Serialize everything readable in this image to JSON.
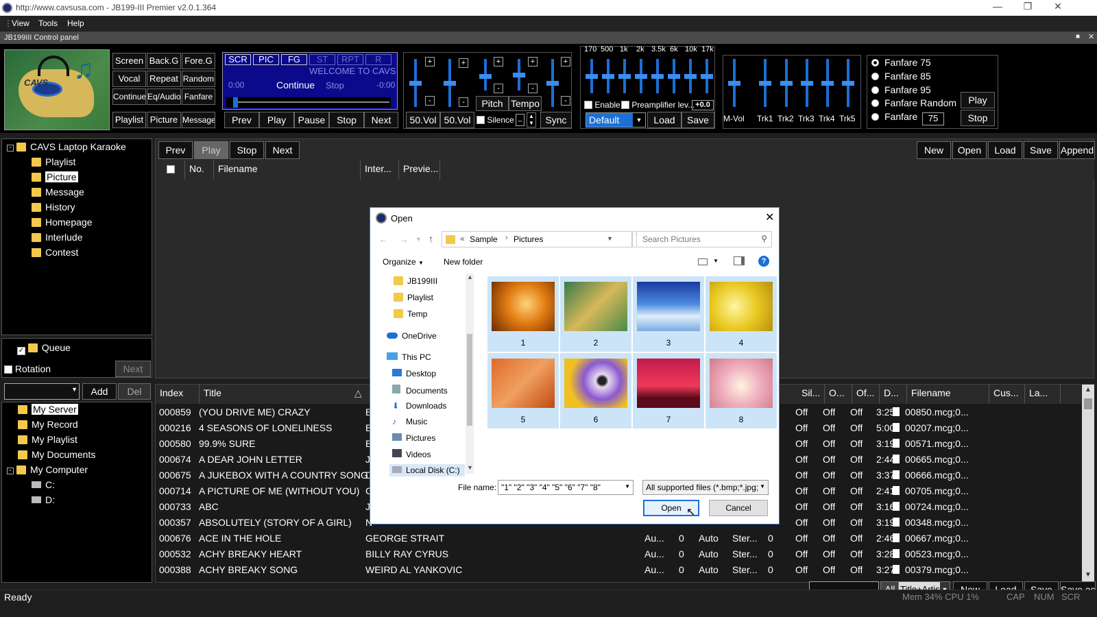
{
  "window": {
    "title": "http://www.cavsusa.com - JB199-III Premier v2.0.1.364"
  },
  "menu": [
    "View",
    "Tools",
    "Help"
  ],
  "control_panel_title": "JB199III Control panel",
  "mode_buttons": [
    [
      "Screen",
      "Back.G",
      "Fore.G"
    ],
    [
      "Vocal",
      "Repeat",
      "Random"
    ],
    [
      "Continue",
      "Eq/Audio",
      "Fanfare"
    ],
    [
      "Playlist",
      "Picture",
      "Message"
    ]
  ],
  "display": {
    "tabs": [
      "SCR",
      "PIC",
      "FG",
      "ST",
      "RPT",
      "R"
    ],
    "welcome": "WELCOME TO CAVS",
    "time_start": "0:00",
    "mode": "Continue",
    "state": "Stop",
    "time_end": "-0:00"
  },
  "transport": [
    "Prev",
    "Play",
    "Pause",
    "Stop",
    "Next"
  ],
  "vol": {
    "vol1": "50.Vol",
    "vol2": "50.Vol",
    "silence": "Silence",
    "pitch": "Pitch",
    "tempo": "Tempo",
    "sync": "Sync"
  },
  "eq": {
    "bands": [
      "170",
      "500",
      "1k",
      "2k",
      "3.5k",
      "6k",
      "10k",
      "17k"
    ],
    "enable": "Enable",
    "preamp": "Preamplifier lev...",
    "preamp_value": "+0.0",
    "preset": "Default",
    "load": "Load",
    "save": "Save"
  },
  "tracks": [
    "M-Vol",
    "Trk1",
    "Trk2",
    "Trk3",
    "Trk4",
    "Trk5"
  ],
  "fanfare": {
    "options": [
      "Fanfare 75",
      "Fanfare 85",
      "Fanfare 95",
      "Fanfare Random",
      "Fanfare"
    ],
    "value": "75",
    "play": "Play",
    "stop": "Stop"
  },
  "tree_top": {
    "root": "CAVS Laptop Karaoke",
    "items": [
      "Playlist",
      "Picture",
      "Message",
      "History",
      "Homepage",
      "Interlude",
      "Contest"
    ]
  },
  "queue": {
    "label": "Queue",
    "rotation": "Rotation",
    "next": "Next"
  },
  "add_del": {
    "add": "Add",
    "del": "Del"
  },
  "tree_bottom": {
    "items": [
      "My Server",
      "My Record",
      "My Playlist",
      "My Documents",
      "My Computer"
    ],
    "drives": [
      "C:",
      "D:"
    ]
  },
  "playlist_toolbar": {
    "left": [
      "Prev",
      "Play",
      "Stop",
      "Next"
    ],
    "right": [
      "New",
      "Open",
      "Load",
      "Save",
      "Append"
    ]
  },
  "playlist_columns": [
    "No.",
    "Filename",
    "Inter...",
    "Previe..."
  ],
  "song_columns": [
    "Index",
    "Title",
    "Sil...",
    "O...",
    "Of...",
    "D...",
    "Filename",
    "Cus...",
    "La..."
  ],
  "songs": [
    {
      "index": "000859",
      "title": "(YOU DRIVE ME) CRAZY",
      "artist": "B",
      "a": "",
      "b": "",
      "c": "",
      "d": "",
      "e": "",
      "f": "",
      "sil": "Off",
      "o": "Off",
      "of": "Off",
      "dur": "3:25",
      "file": "00850.mcg;0..."
    },
    {
      "index": "000216",
      "title": "4 SEASONS OF LONELINESS",
      "artist": "B",
      "a": "",
      "b": "",
      "c": "",
      "d": "",
      "e": "",
      "f": "",
      "sil": "Off",
      "o": "Off",
      "of": "Off",
      "dur": "5:00",
      "file": "00207.mcg;0..."
    },
    {
      "index": "000580",
      "title": "99.9% SURE",
      "artist": "B",
      "a": "",
      "b": "",
      "c": "",
      "d": "",
      "e": "",
      "f": "",
      "sil": "Off",
      "o": "Off",
      "of": "Off",
      "dur": "3:19",
      "file": "00571.mcg;0..."
    },
    {
      "index": "000674",
      "title": "A DEAR JOHN LETTER",
      "artist": "J",
      "a": "",
      "b": "",
      "c": "",
      "d": "",
      "e": "",
      "f": "",
      "sil": "Off",
      "o": "Off",
      "of": "Off",
      "dur": "2:44",
      "file": "00665.mcg;0..."
    },
    {
      "index": "000675",
      "title": "A JUKEBOX WITH A COUNTRY SONG",
      "artist": "D",
      "a": "",
      "b": "",
      "c": "",
      "d": "",
      "e": "",
      "f": "",
      "sil": "Off",
      "o": "Off",
      "of": "Off",
      "dur": "3:37",
      "file": "00666.mcg;0..."
    },
    {
      "index": "000714",
      "title": "A PICTURE OF ME (WITHOUT YOU)",
      "artist": "C",
      "a": "",
      "b": "",
      "c": "",
      "d": "",
      "e": "",
      "f": "",
      "sil": "Off",
      "o": "Off",
      "of": "Off",
      "dur": "2:41",
      "file": "00705.mcg;0..."
    },
    {
      "index": "000733",
      "title": "ABC",
      "artist": "J",
      "a": "",
      "b": "",
      "c": "",
      "d": "",
      "e": "",
      "f": "",
      "sil": "Off",
      "o": "Off",
      "of": "Off",
      "dur": "3:16",
      "file": "00724.mcg;0..."
    },
    {
      "index": "000357",
      "title": "ABSOLUTELY (STORY OF A GIRL)",
      "artist": "N",
      "a": "",
      "b": "",
      "c": "",
      "d": "",
      "e": "",
      "f": "",
      "sil": "Off",
      "o": "Off",
      "of": "Off",
      "dur": "3:19",
      "file": "00348.mcg;0..."
    },
    {
      "index": "000676",
      "title": "ACE IN THE HOLE",
      "artist": "GEORGE STRAIT",
      "a": "Au...",
      "b": "0",
      "c": "Auto",
      "d": "Ster...",
      "e": "0",
      "f": "",
      "sil": "Off",
      "o": "Off",
      "of": "Off",
      "dur": "2:46",
      "file": "00667.mcg;0..."
    },
    {
      "index": "000532",
      "title": "ACHY BREAKY HEART",
      "artist": "BILLY RAY CYRUS",
      "a": "Au...",
      "b": "0",
      "c": "Auto",
      "d": "Ster...",
      "e": "0",
      "f": "",
      "sil": "Off",
      "o": "Off",
      "of": "Off",
      "dur": "3:28",
      "file": "00523.mcg;0..."
    },
    {
      "index": "000388",
      "title": "ACHY BREAKY SONG",
      "artist": "WEIRD AL YANKOVIC",
      "a": "Au...",
      "b": "0",
      "c": "Auto",
      "d": "Ster...",
      "e": "0",
      "f": "",
      "sil": "Off",
      "o": "Off",
      "of": "Off",
      "dur": "3:27",
      "file": "00379.mcg;0..."
    }
  ],
  "bottom_bar": {
    "all": "All",
    "filter": "Title+Artist",
    "buttons": [
      "New",
      "Load",
      "Save",
      "Save as"
    ]
  },
  "status": {
    "left": "Ready",
    "mem": "Mem 34% CPU  1%",
    "cap": "CAP",
    "num": "NUM",
    "scr": "SCR"
  },
  "dialog": {
    "title": "Open",
    "path": [
      "Sample",
      "Pictures"
    ],
    "search_placeholder": "Search Pictures",
    "organize": "Organize",
    "new_folder": "New folder",
    "nav": [
      "JB199III",
      "Playlist",
      "Temp",
      "OneDrive",
      "This PC",
      "Desktop",
      "Documents",
      "Downloads",
      "Music",
      "Pictures",
      "Videos",
      "Local Disk (C:)"
    ],
    "thumbnails": [
      "1",
      "2",
      "3",
      "4",
      "5",
      "6",
      "7",
      "8"
    ],
    "filename_label": "File name:",
    "filename_value": "\"1\" \"2\" \"3\" \"4\" \"5\" \"6\" \"7\" \"8\"",
    "filetype": "All supported files (*.bmp;*.jpg;",
    "open": "Open",
    "cancel": "Cancel"
  },
  "colors": {
    "accent_blue": "#1c6fd6",
    "folder": "#f2c94c",
    "dialog_border": "#3b78d0",
    "selection": "#cce4f7"
  }
}
